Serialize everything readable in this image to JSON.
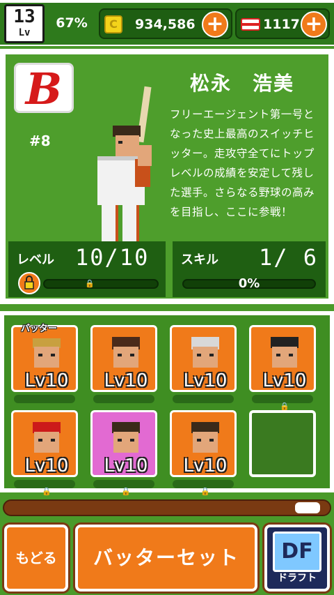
{
  "header": {
    "user_level": "13",
    "level_label": "Lv",
    "exp_percent": "67%",
    "coins": "934,586",
    "tickets": "1117",
    "plus_symbol": "+"
  },
  "player": {
    "name": "松永　浩美",
    "uniform_number": "#8",
    "team_letter": "B",
    "description": "フリーエージェント第一号となった史上最高のスイッチヒッター。走攻守全てにトップレベルの成績を安定して残した選手。さらなる野球の高みを目指し、ここに参戦！",
    "level_label": "レベル",
    "level_value": "10/10",
    "level_progress": 0,
    "skill_label": "スキル",
    "skill_value": "1/ 6",
    "skill_percent": "0%",
    "skill_progress": 0
  },
  "roster": {
    "batter_tag": "バッター",
    "slots": [
      {
        "level": "Lv10",
        "frame": "orange"
      },
      {
        "level": "Lv10",
        "frame": "orange"
      },
      {
        "level": "Lv10",
        "frame": "orange"
      },
      {
        "level": "Lv10",
        "frame": "orange"
      },
      {
        "level": "Lv10",
        "frame": "orange"
      },
      {
        "level": "Lv10",
        "frame": "pink"
      },
      {
        "level": "Lv10",
        "frame": "orange"
      },
      {
        "level": "",
        "frame": "empty"
      }
    ],
    "scroll_position": 0.92
  },
  "buttons": {
    "back_label": "もどる",
    "batter_set_label": "バッターセット",
    "draft_icon_text": "DF",
    "draft_label": "ドラフト"
  },
  "colors": {
    "accent_orange": "#f07a1a",
    "field_green": "#4a9a2a",
    "dark_green": "#1f5f12",
    "coin_yellow": "#f4d31a"
  },
  "icons": {
    "coin": "coin-icon",
    "ticket": "ticket-icon",
    "lock": "lock-icon"
  }
}
